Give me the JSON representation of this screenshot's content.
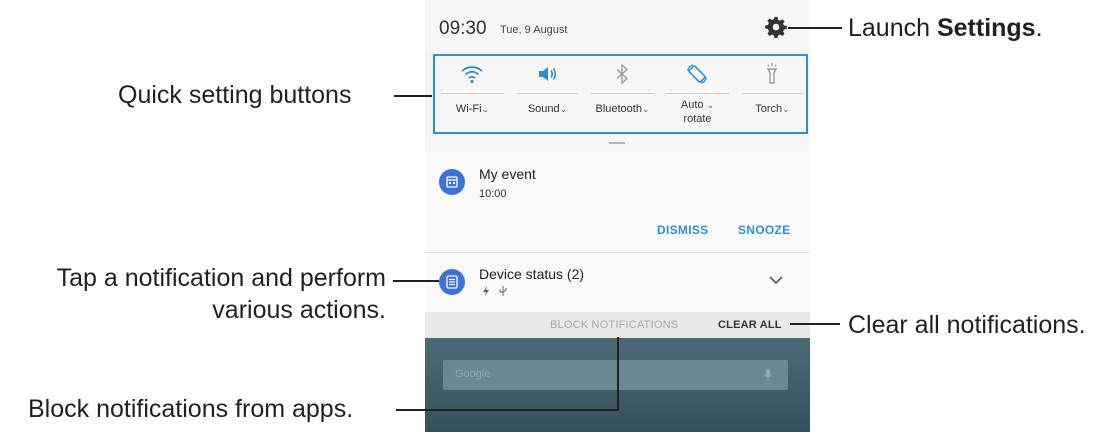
{
  "status_bar": {
    "time": "09:30",
    "date": "Tue, 9 August"
  },
  "quick_settings": [
    {
      "label": "Wi-Fi",
      "icon": "wifi-icon"
    },
    {
      "label": "Sound",
      "icon": "sound-icon"
    },
    {
      "label": "Bluetooth",
      "icon": "bluetooth-icon"
    },
    {
      "label": "Auto\nrotate",
      "label_line1": "Auto",
      "label_line2": "rotate",
      "icon": "auto-rotate-icon"
    },
    {
      "label": "Torch",
      "icon": "torch-icon"
    }
  ],
  "notifications": [
    {
      "title": "My event",
      "subtitle": "10:00",
      "icon": "calendar-icon",
      "actions": [
        "DISMISS",
        "SNOOZE"
      ]
    },
    {
      "title": "Device status (2)",
      "icon": "list-icon",
      "subicons": [
        "charging-icon",
        "usb-icon"
      ]
    }
  ],
  "footer": {
    "block_label": "BLOCK NOTIFICATIONS",
    "clear_label": "CLEAR ALL"
  },
  "home_search": {
    "hint": "Google"
  },
  "callouts": {
    "settings_prefix": "Launch ",
    "settings_bold": "Settings",
    "settings_suffix": ".",
    "quick_settings": "Quick setting buttons",
    "tap_line1": "Tap a notification and perform",
    "tap_line2": "various actions.",
    "clear_all": "Clear all notifications.",
    "block": "Block notifications from apps."
  },
  "colors": {
    "accent": "#2d8fd6",
    "highlight_border": "#2f8fd5",
    "notif_icon": "#3d73d9"
  }
}
